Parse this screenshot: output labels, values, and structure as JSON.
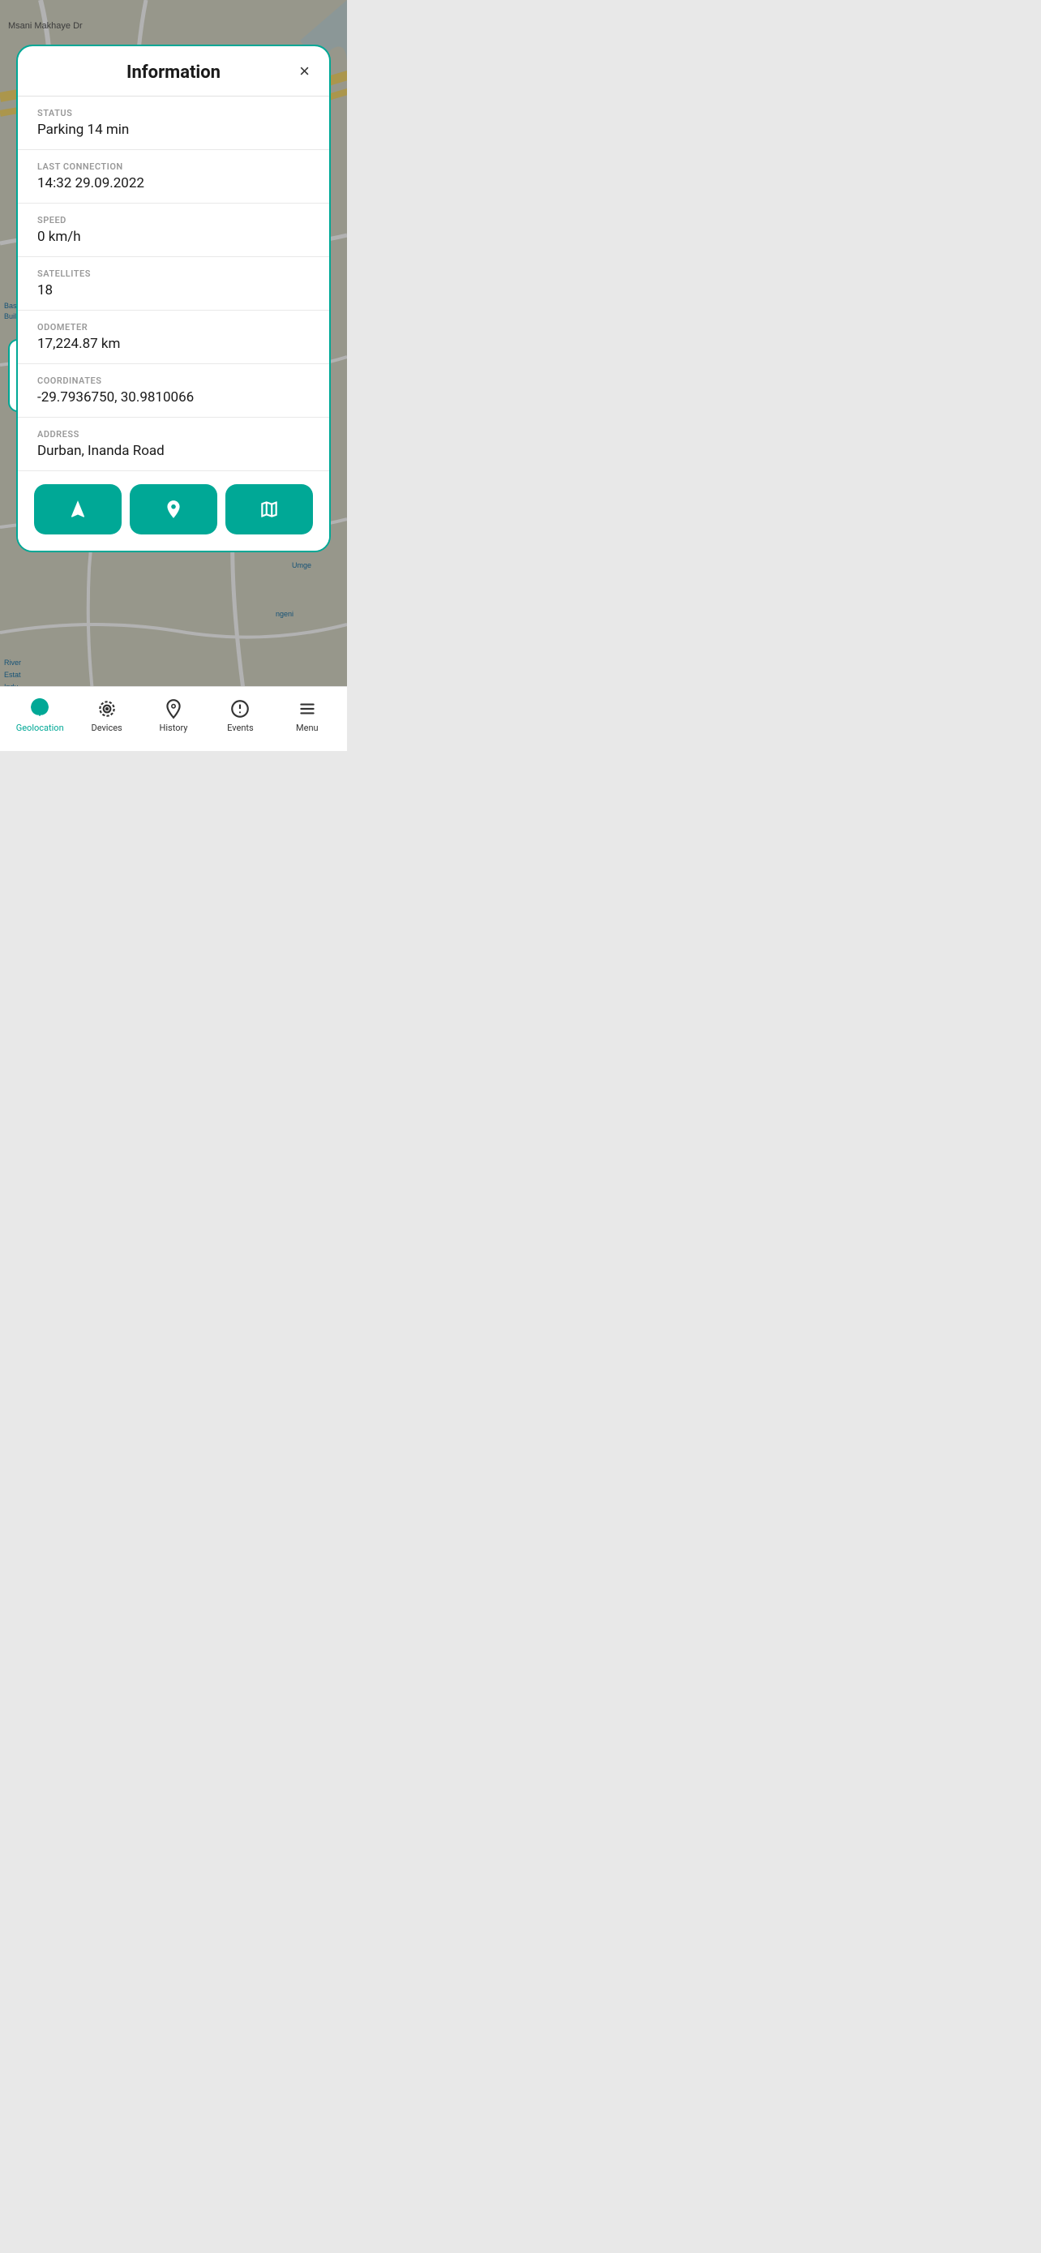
{
  "modal": {
    "title": "Information",
    "close_label": "×",
    "fields": [
      {
        "label": "STATUS",
        "value": "Parking 14 min"
      },
      {
        "label": "LAST CONNECTION",
        "value": "14:32 29.09.2022"
      },
      {
        "label": "SPEED",
        "value": "0 km/h"
      },
      {
        "label": "SATELLITES",
        "value": "18"
      },
      {
        "label": "ODOMETER",
        "value": "17,224.87 km"
      },
      {
        "label": "COORDINATES",
        "value": "-29.7936750, 30.9810066"
      },
      {
        "label": "ADDRESS",
        "value": "Durban, Inanda Road"
      }
    ]
  },
  "actions": [
    {
      "id": "navigate",
      "label": "Navigate"
    },
    {
      "id": "location",
      "label": "Location"
    },
    {
      "id": "map",
      "label": "Map"
    }
  ],
  "bottomNav": {
    "items": [
      {
        "id": "geolocation",
        "label": "Geolocation",
        "active": true
      },
      {
        "id": "devices",
        "label": "Devices",
        "active": false
      },
      {
        "id": "history",
        "label": "History",
        "active": false
      },
      {
        "id": "events",
        "label": "Events",
        "active": false
      },
      {
        "id": "menu",
        "label": "Menu",
        "active": false
      }
    ]
  },
  "colors": {
    "accent": "#00a896",
    "text_primary": "#1a1a1a",
    "text_secondary": "#999999"
  }
}
